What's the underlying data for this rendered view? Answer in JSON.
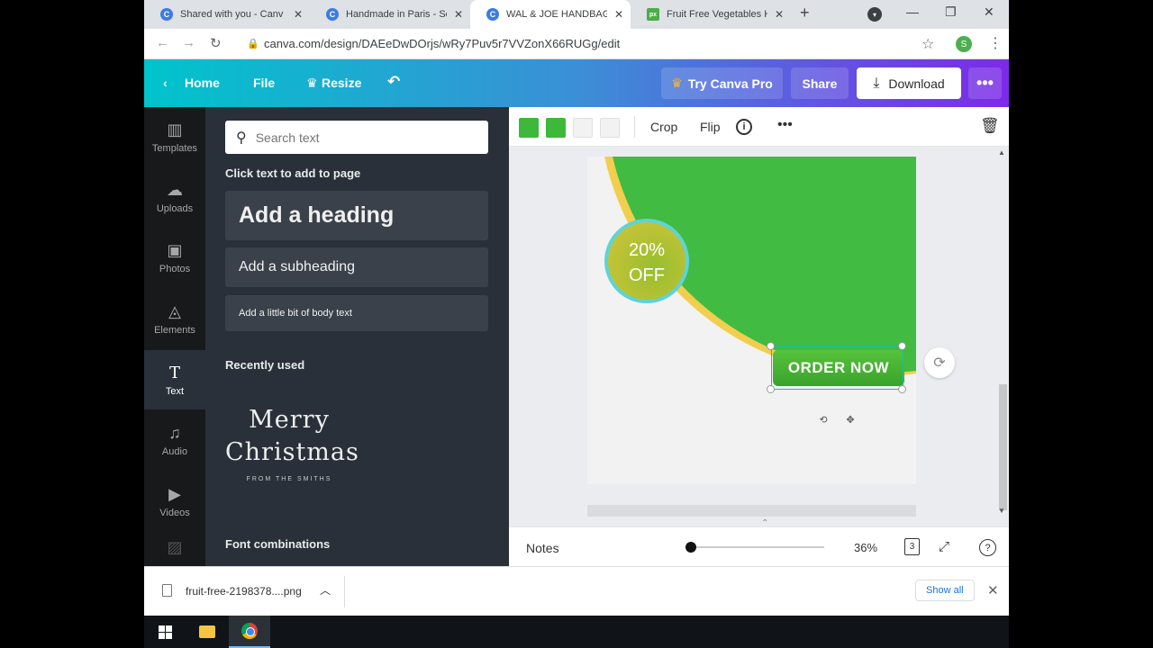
{
  "browser": {
    "tabs": [
      {
        "label": "Shared with you - Canv",
        "favicon": "C"
      },
      {
        "label": "Handmade in Paris - So",
        "favicon": "C"
      },
      {
        "label": "WAL & JOE HANDBAG",
        "favicon": "C"
      },
      {
        "label": "Fruit Free Vegetables H",
        "favicon": "px"
      }
    ],
    "new_tab": "+",
    "url": "canva.com/design/DAEeDwDOrjs/wRy7Puv5r7VVZonX66RUGg/edit",
    "profile_initial": "S"
  },
  "header": {
    "home": "Home",
    "file": "File",
    "resize": "Resize",
    "try_pro": "Try Canva Pro",
    "share": "Share",
    "download": "Download"
  },
  "sidebar": {
    "items": [
      {
        "label": "Templates",
        "icon": "templates-icon"
      },
      {
        "label": "Uploads",
        "icon": "upload-cloud-icon"
      },
      {
        "label": "Photos",
        "icon": "photo-icon"
      },
      {
        "label": "Elements",
        "icon": "shapes-icon"
      },
      {
        "label": "Text",
        "icon": "text-icon"
      },
      {
        "label": "Audio",
        "icon": "music-note-icon"
      },
      {
        "label": "Videos",
        "icon": "video-icon"
      }
    ],
    "active": "Text"
  },
  "text_panel": {
    "search_placeholder": "Search text",
    "click_hint": "Click text to add to page",
    "add_heading": "Add a heading",
    "add_subheading": "Add a subheading",
    "add_body": "Add a little bit of body text",
    "recently_used": "Recently used",
    "recent_item": {
      "line1": "Merry",
      "line2": "Christmas",
      "line3": "FROM THE SMITHS"
    },
    "font_combinations": "Font combinations"
  },
  "toolbar": {
    "colors": [
      "#3db83a",
      "#3db83a",
      "#f2f2f2",
      "#f2f2f2"
    ],
    "crop": "Crop",
    "flip": "Flip"
  },
  "design": {
    "badge_line1": "20%",
    "badge_line2": "OFF",
    "order_button": "ORDER NOW",
    "colors": {
      "green": "#41bb42",
      "yellow": "#f2ce4f",
      "teal": "#5ed3d8"
    }
  },
  "bottom": {
    "notes": "Notes",
    "zoom": "36%",
    "page_count": "3"
  },
  "download_bar": {
    "file": "fruit-free-2198378....png",
    "show_all": "Show all"
  }
}
